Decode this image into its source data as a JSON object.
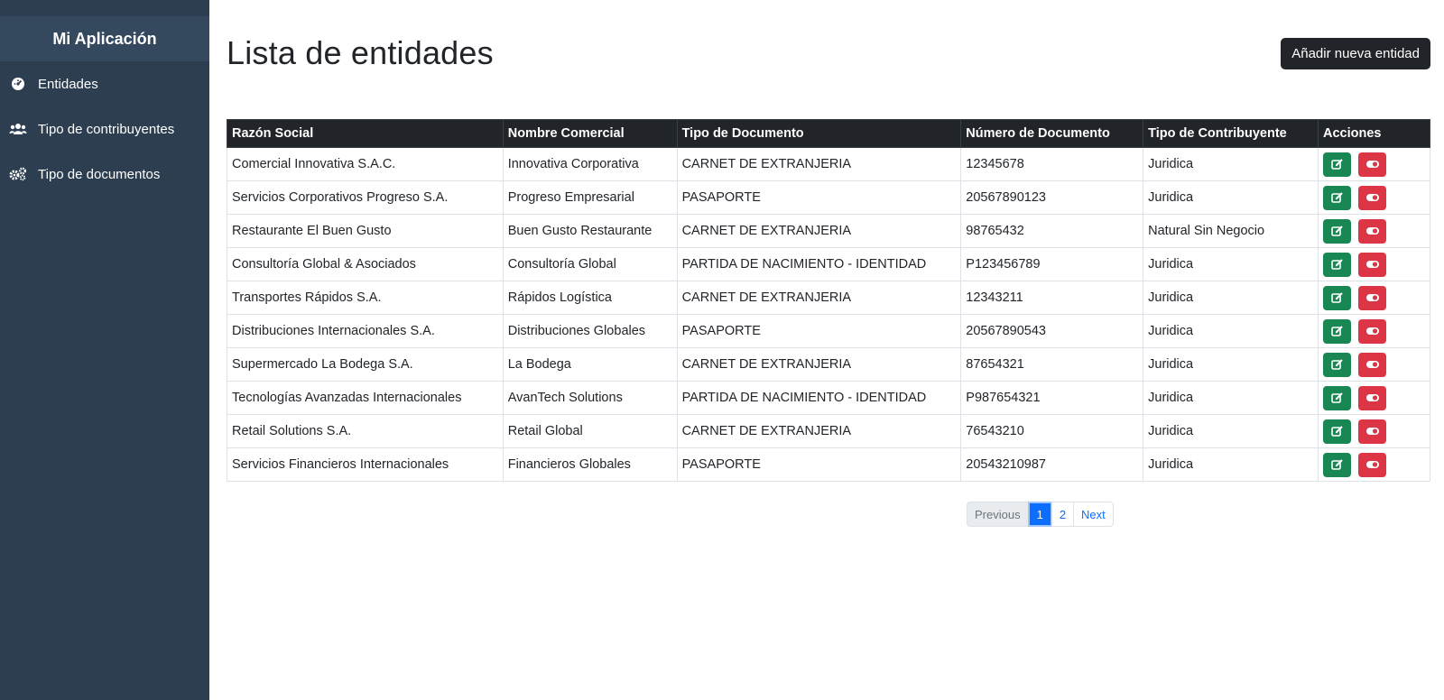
{
  "sidebar": {
    "brand": "Mi Aplicación",
    "items": [
      {
        "label": "Entidades",
        "icon": "dashboard-icon"
      },
      {
        "label": "Tipo de contribuyentes",
        "icon": "users-icon"
      },
      {
        "label": "Tipo de documentos",
        "icon": "gears-icon"
      }
    ]
  },
  "main": {
    "title": "Lista de entidades",
    "add_button": "Añadir nueva entidad"
  },
  "table": {
    "headers": [
      "Razón Social",
      "Nombre Comercial",
      "Tipo de Documento",
      "Número de Documento",
      "Tipo de Contribuyente",
      "Acciones"
    ],
    "rows": [
      [
        "Comercial Innovativa S.A.C.",
        "Innovativa Corporativa",
        "CARNET DE EXTRANJERIA",
        "12345678",
        "Juridica"
      ],
      [
        "Servicios Corporativos Progreso S.A.",
        "Progreso Empresarial",
        "PASAPORTE",
        "20567890123",
        "Juridica"
      ],
      [
        "Restaurante El Buen Gusto",
        "Buen Gusto Restaurante",
        "CARNET DE EXTRANJERIA",
        "98765432",
        "Natural Sin Negocio"
      ],
      [
        "Consultoría Global & Asociados",
        "Consultoría Global",
        "PARTIDA DE NACIMIENTO - IDENTIDAD",
        "P123456789",
        "Juridica"
      ],
      [
        "Transportes Rápidos S.A.",
        "Rápidos Logística",
        "CARNET DE EXTRANJERIA",
        "12343211",
        "Juridica"
      ],
      [
        "Distribuciones Internacionales S.A.",
        "Distribuciones Globales",
        "PASAPORTE",
        "20567890543",
        "Juridica"
      ],
      [
        "Supermercado La Bodega S.A.",
        "La Bodega",
        "CARNET DE EXTRANJERIA",
        "87654321",
        "Juridica"
      ],
      [
        "Tecnologías Avanzadas Internacionales",
        "AvanTech Solutions",
        "PARTIDA DE NACIMIENTO - IDENTIDAD",
        "P987654321",
        "Juridica"
      ],
      [
        "Retail Solutions S.A.",
        "Retail Global",
        "CARNET DE EXTRANJERIA",
        "76543210",
        "Juridica"
      ],
      [
        "Servicios Financieros Internacionales",
        "Financieros Globales",
        "PASAPORTE",
        "20543210987",
        "Juridica"
      ]
    ]
  },
  "pagination": {
    "previous": "Previous",
    "pages": [
      "1",
      "2"
    ],
    "current": "1",
    "next": "Next"
  },
  "colors": {
    "sidebar_bg": "#2c3e50",
    "brand_bg": "#34495e",
    "header_bg": "#212529",
    "edit": "#198754",
    "delete": "#dc3545",
    "primary": "#0d6efd"
  }
}
